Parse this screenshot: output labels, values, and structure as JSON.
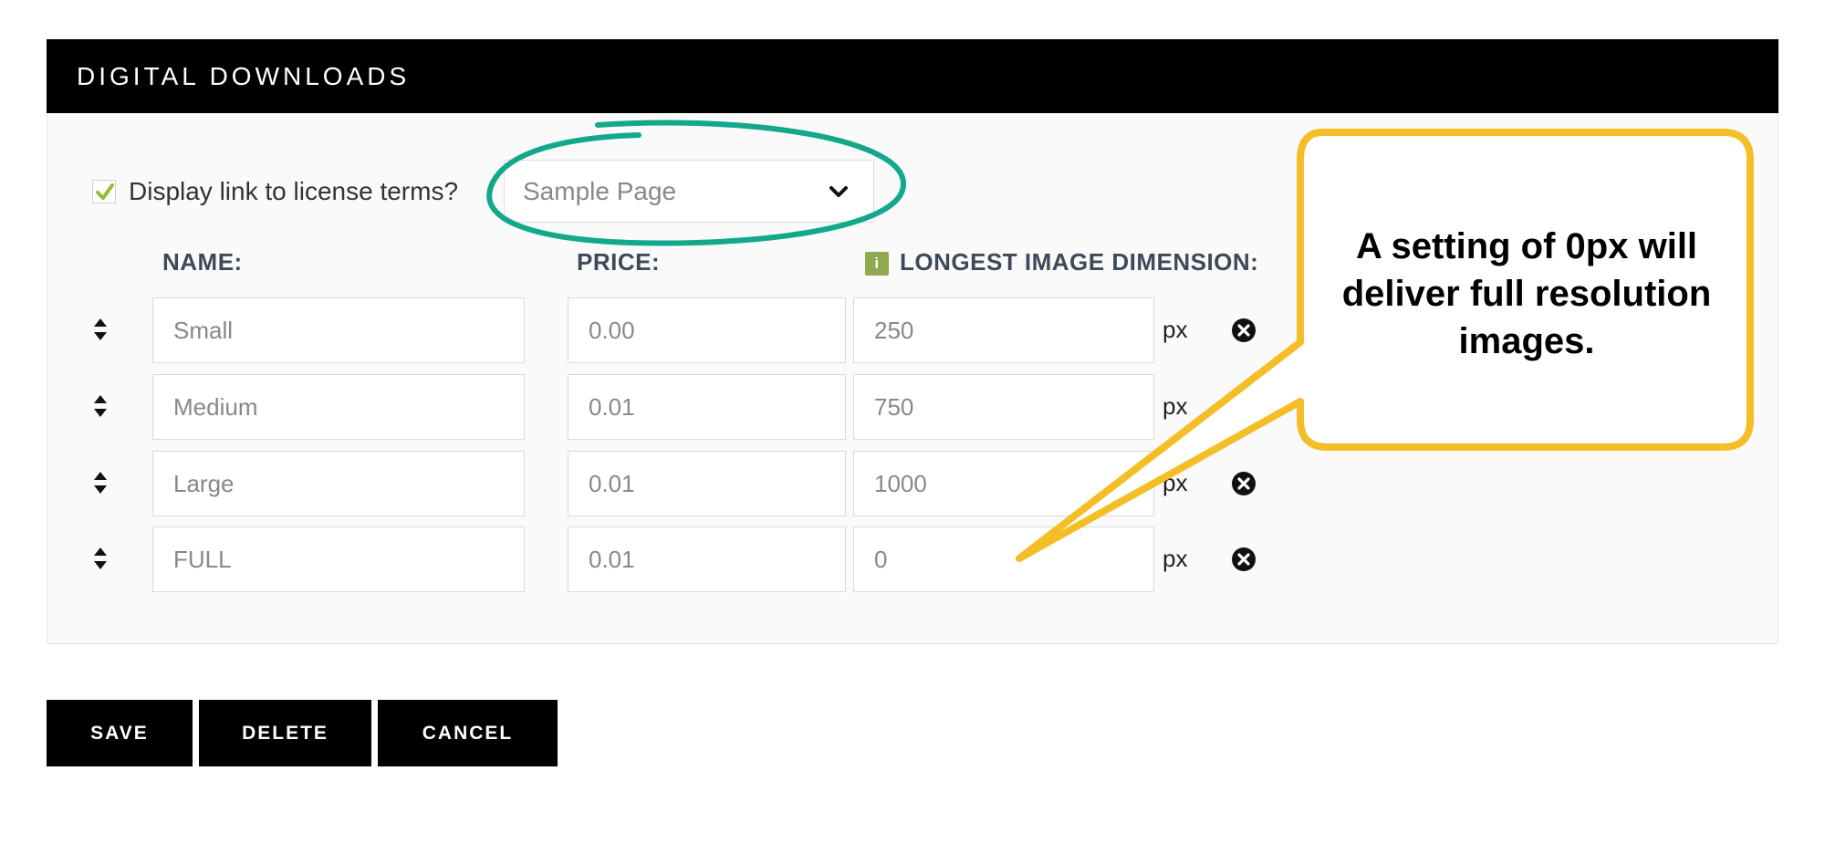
{
  "panel": {
    "title": "DIGITAL DOWNLOADS"
  },
  "license": {
    "checked": true,
    "label": "Display link to license terms?",
    "page_select_value": "Sample Page"
  },
  "columns": {
    "name": "NAME:",
    "price": "PRICE:",
    "dimension": "LONGEST IMAGE DIMENSION:",
    "info_badge": "i"
  },
  "rows": [
    {
      "name": "Small",
      "price": "0.00",
      "dimension": "250",
      "unit": "px"
    },
    {
      "name": "Medium",
      "price": "0.01",
      "dimension": "750",
      "unit": "px"
    },
    {
      "name": "Large",
      "price": "0.01",
      "dimension": "1000",
      "unit": "px"
    },
    {
      "name": "FULL",
      "price": "0.01",
      "dimension": "0",
      "unit": "px"
    }
  ],
  "buttons": {
    "save": "SAVE",
    "delete": "DELETE",
    "cancel": "CANCEL"
  },
  "callout": {
    "text": "A setting of 0px will deliver full resolution images."
  },
  "colors": {
    "header_bg": "#000000",
    "checkbox_check": "#8fbf2f",
    "info_badge": "#8fa94f",
    "annotation_circle": "#13a88c",
    "callout_border": "#f4be27"
  },
  "icons": {
    "sort": "sort-updown-icon",
    "remove": "remove-circle-x-icon",
    "chevron": "chevron-down-icon",
    "check": "checkmark-icon"
  }
}
